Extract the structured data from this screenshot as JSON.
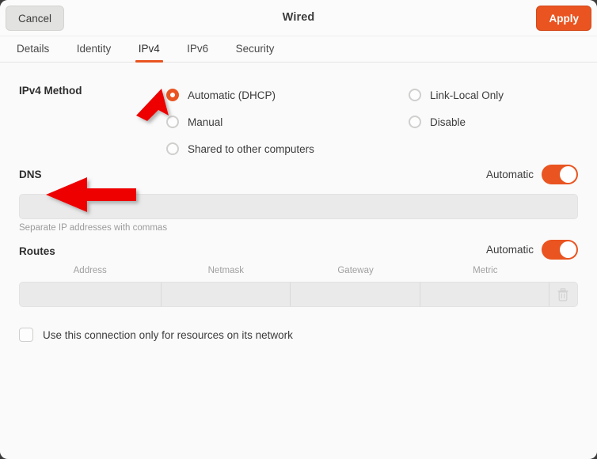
{
  "window": {
    "title": "Wired",
    "cancel_label": "Cancel",
    "apply_label": "Apply",
    "accent_color": "#e95420"
  },
  "tabs": [
    {
      "label": "Details",
      "active": false
    },
    {
      "label": "Identity",
      "active": false
    },
    {
      "label": "IPv4",
      "active": true
    },
    {
      "label": "IPv6",
      "active": false
    },
    {
      "label": "Security",
      "active": false
    }
  ],
  "ipv4_method": {
    "label": "IPv4 Method",
    "options_left": [
      {
        "label": "Automatic (DHCP)",
        "checked": true
      },
      {
        "label": "Manual",
        "checked": false
      },
      {
        "label": "Shared to other computers",
        "checked": false
      }
    ],
    "options_right": [
      {
        "label": "Link-Local Only",
        "checked": false
      },
      {
        "label": "Disable",
        "checked": false
      }
    ]
  },
  "dns": {
    "label": "DNS",
    "automatic_label": "Automatic",
    "automatic_on": true,
    "value": "",
    "placeholder": "",
    "hint": "Separate IP addresses with commas"
  },
  "routes": {
    "label": "Routes",
    "automatic_label": "Automatic",
    "automatic_on": true,
    "columns": [
      "Address",
      "Netmask",
      "Gateway",
      "Metric"
    ],
    "rows": [
      {
        "address": "",
        "netmask": "",
        "gateway": "",
        "metric": ""
      }
    ],
    "delete_icon": "trash-icon"
  },
  "connection_only": {
    "label": "Use this connection only for resources on its network",
    "checked": false
  },
  "annotations": [
    {
      "name": "arrow-to-ipv4-tab",
      "color": "#ee0000",
      "points_to": "IPv4 tab"
    },
    {
      "name": "arrow-to-dns-label",
      "color": "#ee0000",
      "points_to": "DNS"
    }
  ]
}
